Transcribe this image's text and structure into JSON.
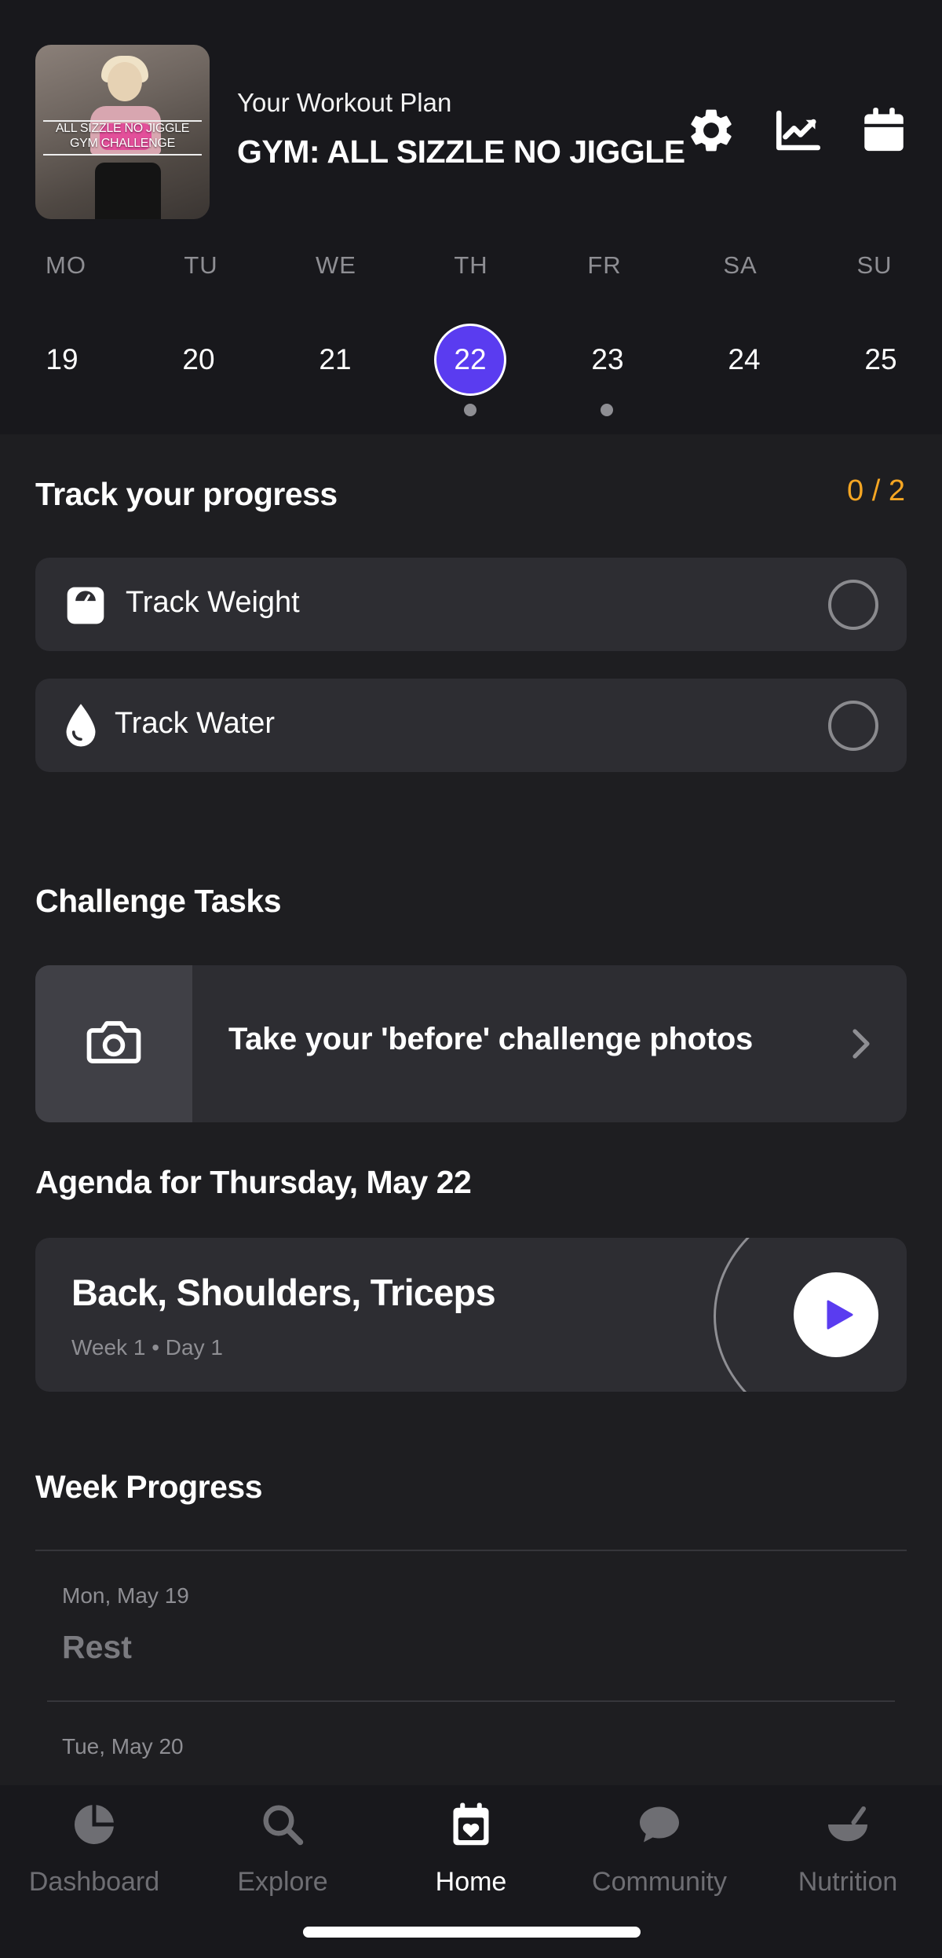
{
  "header": {
    "subtitle": "Your Workout Plan",
    "title": "GYM: ALL SIZZLE NO JIGGLE",
    "thumbnail_text": [
      "ALL SIZZLE NO JIGGLE",
      "GYM CHALLENGE"
    ],
    "icons": [
      "gear-icon",
      "chart-icon",
      "calendar-icon"
    ]
  },
  "week": {
    "weekdays": [
      "MO",
      "TU",
      "WE",
      "TH",
      "FR",
      "SA",
      "SU"
    ],
    "days": [
      "19",
      "20",
      "21",
      "22",
      "23",
      "24",
      "25"
    ],
    "selected_day": "22",
    "days_with_activity": [
      "22",
      "23"
    ]
  },
  "progress": {
    "title": "Track your progress",
    "counter": "0 / 2",
    "items": [
      {
        "label": "Track Weight",
        "icon": "scale-icon",
        "done": false
      },
      {
        "label": "Track Water",
        "icon": "water-drop-icon",
        "done": false
      }
    ]
  },
  "challenge": {
    "title": "Challenge Tasks",
    "task_label": "Take your 'before' challenge photos",
    "task_icon": "camera-icon"
  },
  "agenda": {
    "title": "Agenda for Thursday, May 22",
    "workout_title": "Back, Shoulders, Triceps",
    "workout_sub": "Week 1 • Day 1"
  },
  "week_progress": {
    "title": "Week Progress",
    "entries": [
      {
        "date": "Mon, May 19",
        "status": "Rest"
      },
      {
        "date": "Tue, May 20",
        "status": ""
      }
    ]
  },
  "tabbar": {
    "tabs": [
      {
        "label": "Dashboard",
        "icon": "dashboard-icon"
      },
      {
        "label": "Explore",
        "icon": "search-icon"
      },
      {
        "label": "Home",
        "icon": "calendar-heart-icon"
      },
      {
        "label": "Community",
        "icon": "chat-bubble-icon"
      },
      {
        "label": "Nutrition",
        "icon": "bowl-icon"
      }
    ],
    "active": "Home"
  },
  "colors": {
    "accent": "#5a3cf0",
    "counter": "#f5a623",
    "background": "#1e1e21",
    "card": "#2d2d32"
  }
}
